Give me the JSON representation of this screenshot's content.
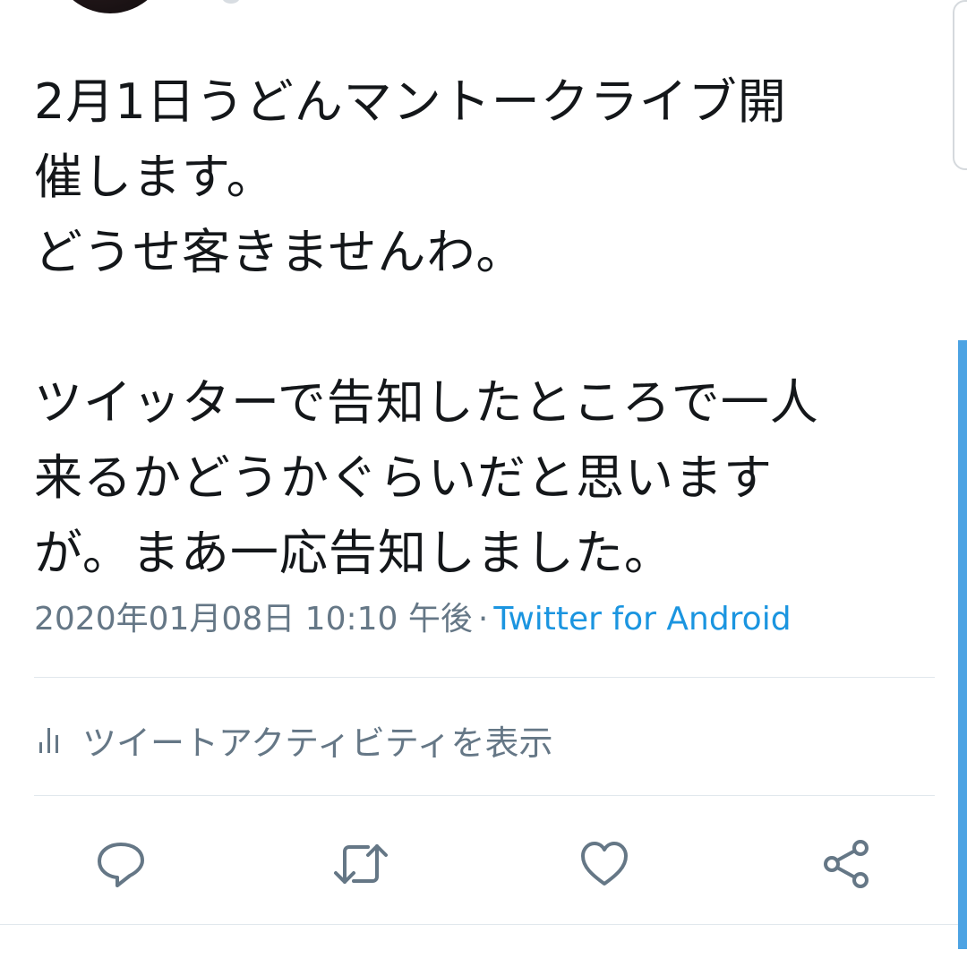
{
  "tweet": {
    "lines": [
      "2月1日うどんマントークライブ開",
      "催します。",
      "どうせ客きませんわ。",
      "",
      "ツイッターで告知したところで一人",
      "来るかどうかぐらいだと思います",
      "が。まあ一応告知しました。"
    ],
    "timestamp": "2020年01月08日 10:10 午後",
    "separator": "·",
    "source": "Twitter for Android"
  },
  "activity": {
    "label": "ツイートアクティビティを表示",
    "icon": "bar-chart-icon"
  },
  "actions": [
    {
      "name": "reply",
      "icon": "reply-icon"
    },
    {
      "name": "retweet",
      "icon": "retweet-icon"
    },
    {
      "name": "like",
      "icon": "heart-icon"
    },
    {
      "name": "share",
      "icon": "share-icon"
    }
  ],
  "colors": {
    "text": "#14171a",
    "muted": "#657786",
    "link": "#1b95e0",
    "scrollbar": "#4da3e3",
    "divider": "#e1e8ed"
  }
}
